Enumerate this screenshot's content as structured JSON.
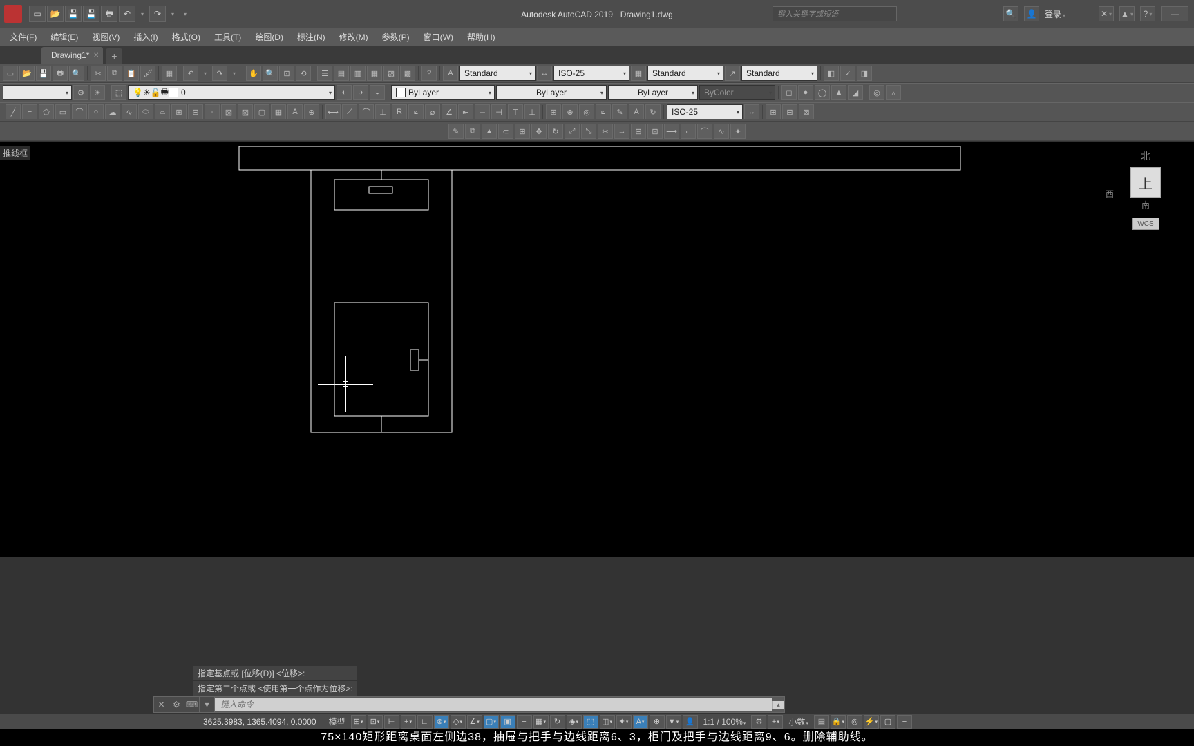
{
  "title": {
    "app": "Autodesk AutoCAD 2019",
    "doc": "Drawing1.dwg"
  },
  "search": {
    "placeholder": "键入关键字或短语"
  },
  "login": {
    "label": "登录"
  },
  "menu": [
    "文件(F)",
    "编辑(E)",
    "视图(V)",
    "插入(I)",
    "格式(O)",
    "工具(T)",
    "绘图(D)",
    "标注(N)",
    "修改(M)",
    "参数(P)",
    "窗口(W)",
    "帮助(H)"
  ],
  "tab": {
    "name": "Drawing1*"
  },
  "combos": {
    "text_style": "Standard",
    "dim_style": "ISO-25",
    "table_style": "Standard",
    "mleader_style": "Standard",
    "layer": "0",
    "color": "ByLayer",
    "linetype": "ByLayer",
    "lineweight": "ByLayer",
    "plot_style": "ByColor",
    "dim_combo": "ISO-25"
  },
  "viewcube": {
    "north": "北",
    "west": "西",
    "south": "南",
    "top": "上",
    "wcs": "WCS"
  },
  "wireframe": "推线框",
  "cmd_history": [
    "指定基点或  [位移(D)]  <位移>:",
    "指定第二个点或  <使用第一个点作为位移>:"
  ],
  "cmd_placeholder": "键入命令",
  "status": {
    "coords": "3625.3983, 1365.4094, 0.0000",
    "model": "模型",
    "scale": "1:1 / 100%",
    "units": "小数"
  },
  "caption": "75×140矩形距离桌面左侧边38，抽屉与把手与边线距离6、3，柜门及把手与边线距离9、6。删除辅助线。"
}
